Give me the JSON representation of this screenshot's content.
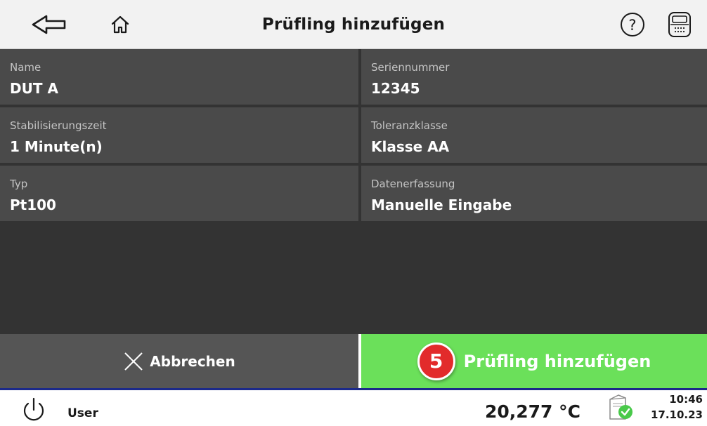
{
  "header": {
    "title": "Prüfling hinzufügen",
    "back_icon": "back-arrow-icon",
    "home_icon": "home-icon",
    "help_icon": "help-icon",
    "device_icon": "calibrator-device-icon"
  },
  "fields": [
    {
      "label": "Name",
      "value": "DUT A"
    },
    {
      "label": "Seriennummer",
      "value": "12345"
    },
    {
      "label": "Stabilisierungszeit",
      "value": "1 Minute(n)"
    },
    {
      "label": "Toleranzklasse",
      "value": "Klasse AA"
    },
    {
      "label": "Typ",
      "value": "Pt100"
    },
    {
      "label": "Datenerfassung",
      "value": "Manuelle Eingabe"
    }
  ],
  "actions": {
    "cancel_label": "Abbrechen",
    "add_label": "Prüfling hinzufügen",
    "step_badge": "5"
  },
  "footer": {
    "user": "User",
    "temperature": "20,277 °C",
    "time": "10:46",
    "date": "17.10.23"
  },
  "colors": {
    "header_bg": "#f2f2f2",
    "field_bg": "#4a4a4a",
    "content_bg": "#333333",
    "add_button": "#6be05a",
    "badge": "#e22b2b",
    "status_ok": "#49c94a",
    "divider": "#1c2a8a"
  }
}
